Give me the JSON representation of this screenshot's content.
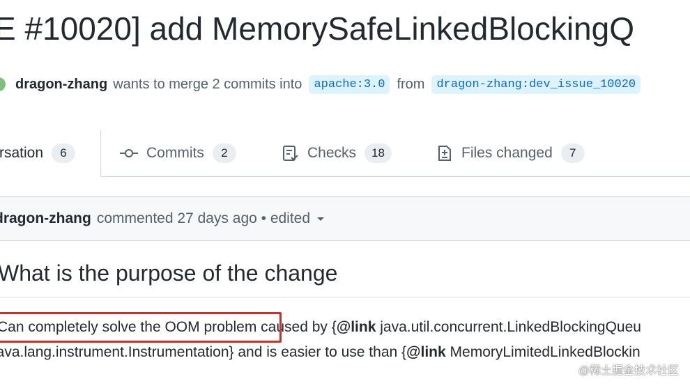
{
  "pr": {
    "title": "E #10020] add MemorySafeLinkedBlockingQ",
    "author": "dragon-zhang",
    "merge_text": "wants to merge 2 commits into",
    "base_branch": "apache:3.0",
    "from_text": "from",
    "head_branch": "dragon-zhang:dev_issue_10020"
  },
  "tabs": [
    {
      "label": "rsation",
      "count": "6",
      "icon": "conversation-icon"
    },
    {
      "label": "Commits",
      "count": "2",
      "icon": "commit-icon"
    },
    {
      "label": "Checks",
      "count": "18",
      "icon": "checklist-icon"
    },
    {
      "label": "Files changed",
      "count": "7",
      "icon": "file-diff-icon"
    }
  ],
  "comment": {
    "author": "dragon-zhang",
    "meta": "commented 27 days ago • edited",
    "heading": "What is the purpose of the change",
    "line1_highlight": "Can completely solve the OOM problem",
    "line1_rest_a": " caused by {",
    "line1_link_kw": "@link",
    "line1_rest_b": " java.util.concurrent.LinkedBlockingQueu",
    "line2_a": "java.lang.instrument.Instrumentation} and is easier to use than {",
    "line2_link_kw": "@link",
    "line2_b": " MemoryLimitedLinkedBlockin"
  },
  "watermark": "@稀土掘金技术社区",
  "colors": {
    "branch_bg": "#ddf4ff",
    "branch_fg": "#0969da",
    "highlight_border": "#c8302a"
  }
}
